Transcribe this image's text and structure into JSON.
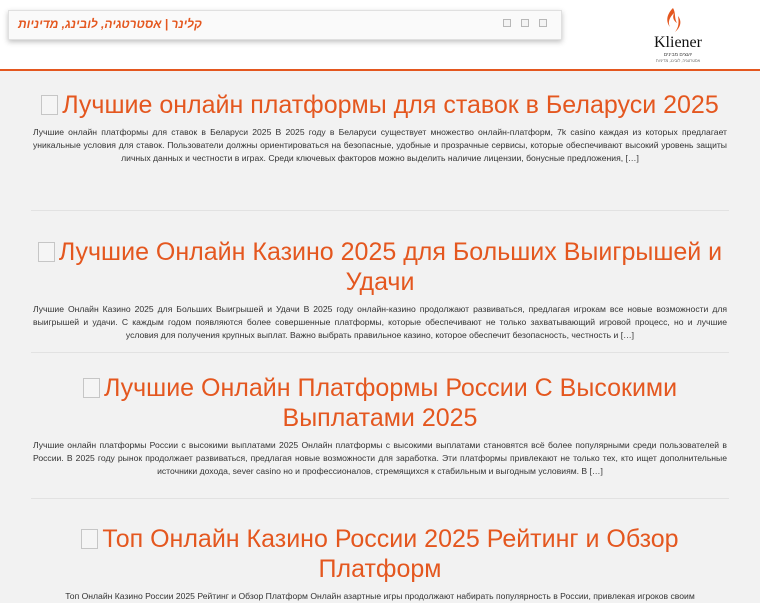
{
  "header": {
    "menu_title": "קלינר | אסטרטגיה, לובינג, מדיניות",
    "logo": {
      "name": "Kliener",
      "tagline_he": "יועצים מבינים",
      "subline_he": "אסטרטגיה, לובינג, מדיניות"
    }
  },
  "colors": {
    "accent": "#e4571f",
    "background": "#f2f2f2",
    "text": "#333333"
  },
  "posts": [
    {
      "title": "Лучшие онлайн платформы для ставок в Беларуси 2025",
      "excerpt": "Лучшие онлайн платформы для ставок в Беларуси 2025 В 2025 году в Беларуси существует множество онлайн-платформ, 7k casino каждая из которых предлагает уникальные условия для ставок. Пользователи должны ориентироваться на безопасные, удобные и прозрачные сервисы, которые обеспечивают высокий уровень защиты личных данных и честности в играх. Среди ключевых факторов можно выделить наличие лицензии, бонусные предложения, […]"
    },
    {
      "title": "Лучшие Онлайн Казино 2025 для Больших Выигрышей и Удачи",
      "excerpt": "Лучшие Онлайн Казино 2025 для Больших Выигрышей и Удачи В 2025 году онлайн-казино продолжают развиваться, предлагая игрокам все новые возможности для выигрышей и удачи. С каждым годом появляются более совершенные платформы, которые обеспечивают не только захватывающий игровой процесс, но и лучшие условия для получения крупных выплат. Важно выбрать правильное казино, которое обеспечит безопасность, честность и […]"
    },
    {
      "title": "Лучшие Онлайн Платформы России С Высокими Выплатами 2025",
      "excerpt": "Лучшие онлайн платформы России с высокими выплатами 2025 Онлайн платформы с высокими выплатами становятся всё более популярными среди пользователей в России. В 2025 году рынок продолжает развиваться, предлагая новые возможности для заработка. Эти платформы привлекают не только тех, кто ищет дополнительные источники дохода, sever casino но и профессионалов, стремящихся к стабильным и выгодным условиям. В […]"
    },
    {
      "title": "Топ Онлайн Казино России 2025 Рейтинг и Обзор Платформ",
      "excerpt": "Топ Онлайн Казино России 2025 Рейтинг и Обзор Платформ Онлайн азартные игры продолжают набирать популярность в России, привлекая игроков своим"
    }
  ]
}
